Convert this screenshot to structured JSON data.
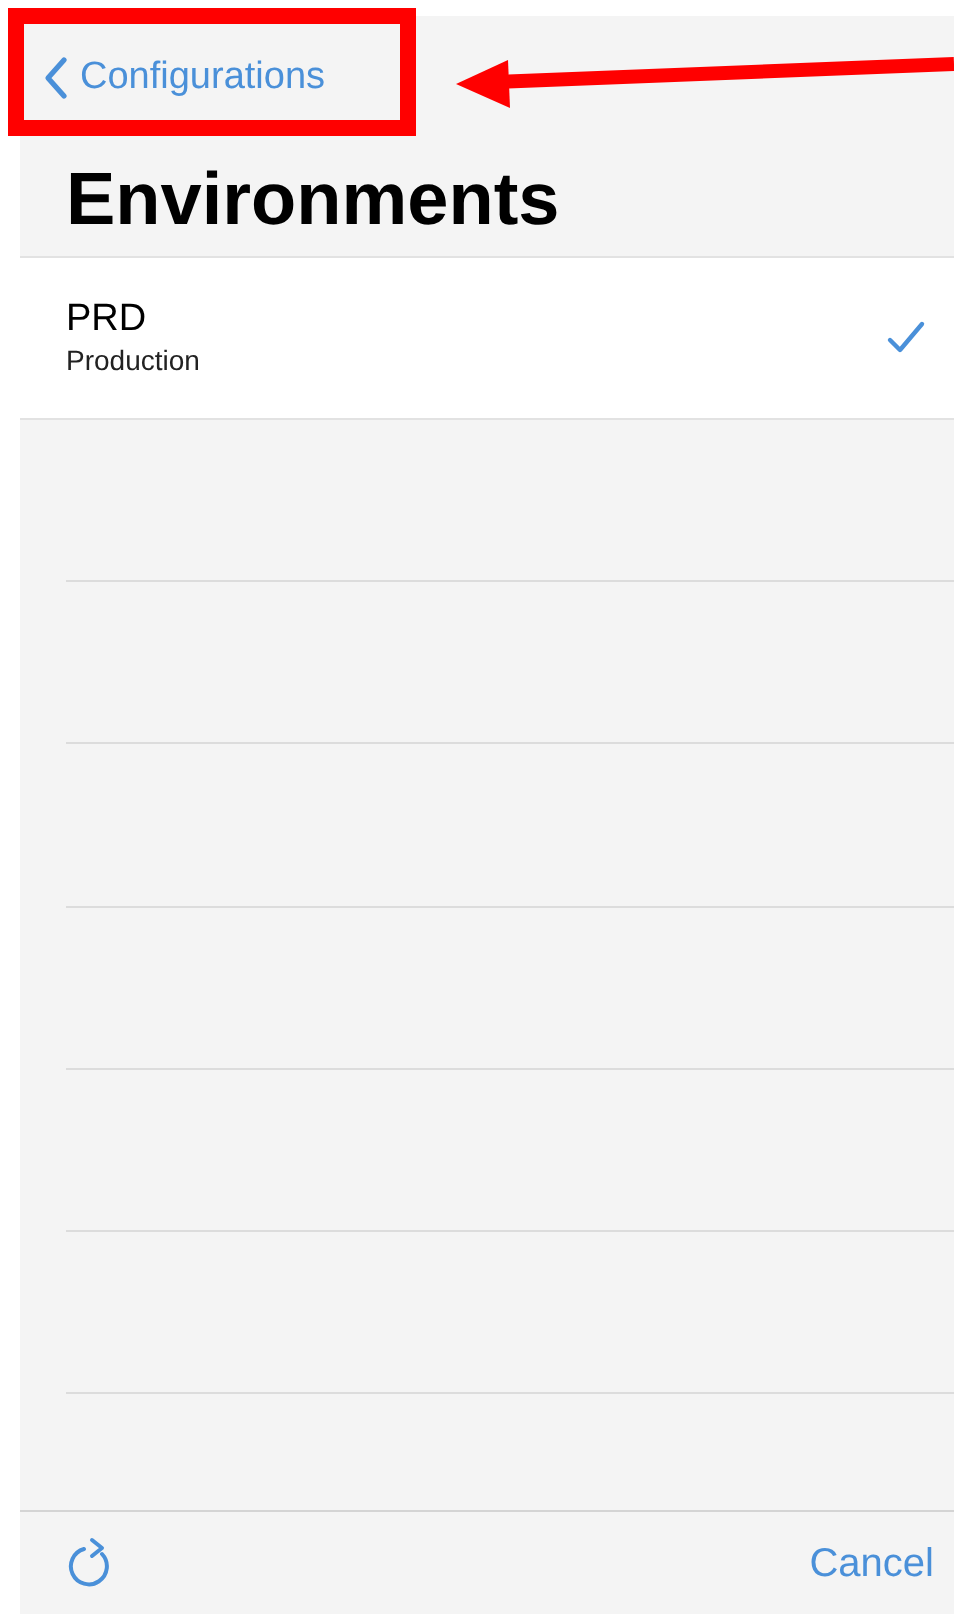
{
  "nav_bar": {
    "back_label": "Configurations"
  },
  "title": "Environments",
  "environments": [
    {
      "code": "PRD",
      "name": "Production",
      "selected": true
    }
  ],
  "toolbar": {
    "cancel_label": "Cancel"
  }
}
